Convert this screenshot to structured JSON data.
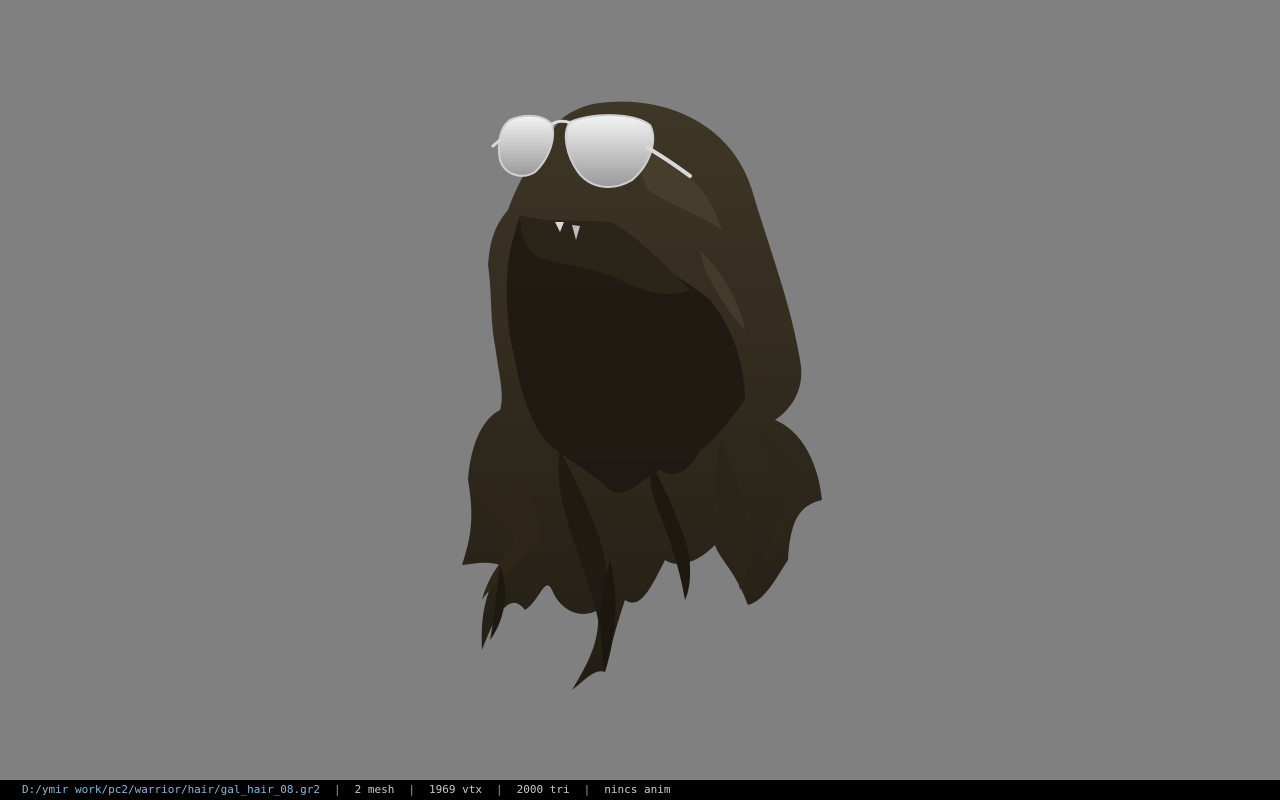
{
  "viewer": {
    "background": "#808080",
    "model": {
      "type": "hair-mesh",
      "hair_color": "#3a3224",
      "accessory": "aviator-sunglasses",
      "accessory_color": "#e8e8e8"
    }
  },
  "statusbar": {
    "background": "#000000",
    "path": "D:/ymir work/pc2/warrior/hair/gal_hair_08.gr2",
    "separator": "|",
    "mesh": "2 mesh",
    "vtx": "1969 vtx",
    "tri": "2000 tri",
    "anim": "nincs anim"
  }
}
